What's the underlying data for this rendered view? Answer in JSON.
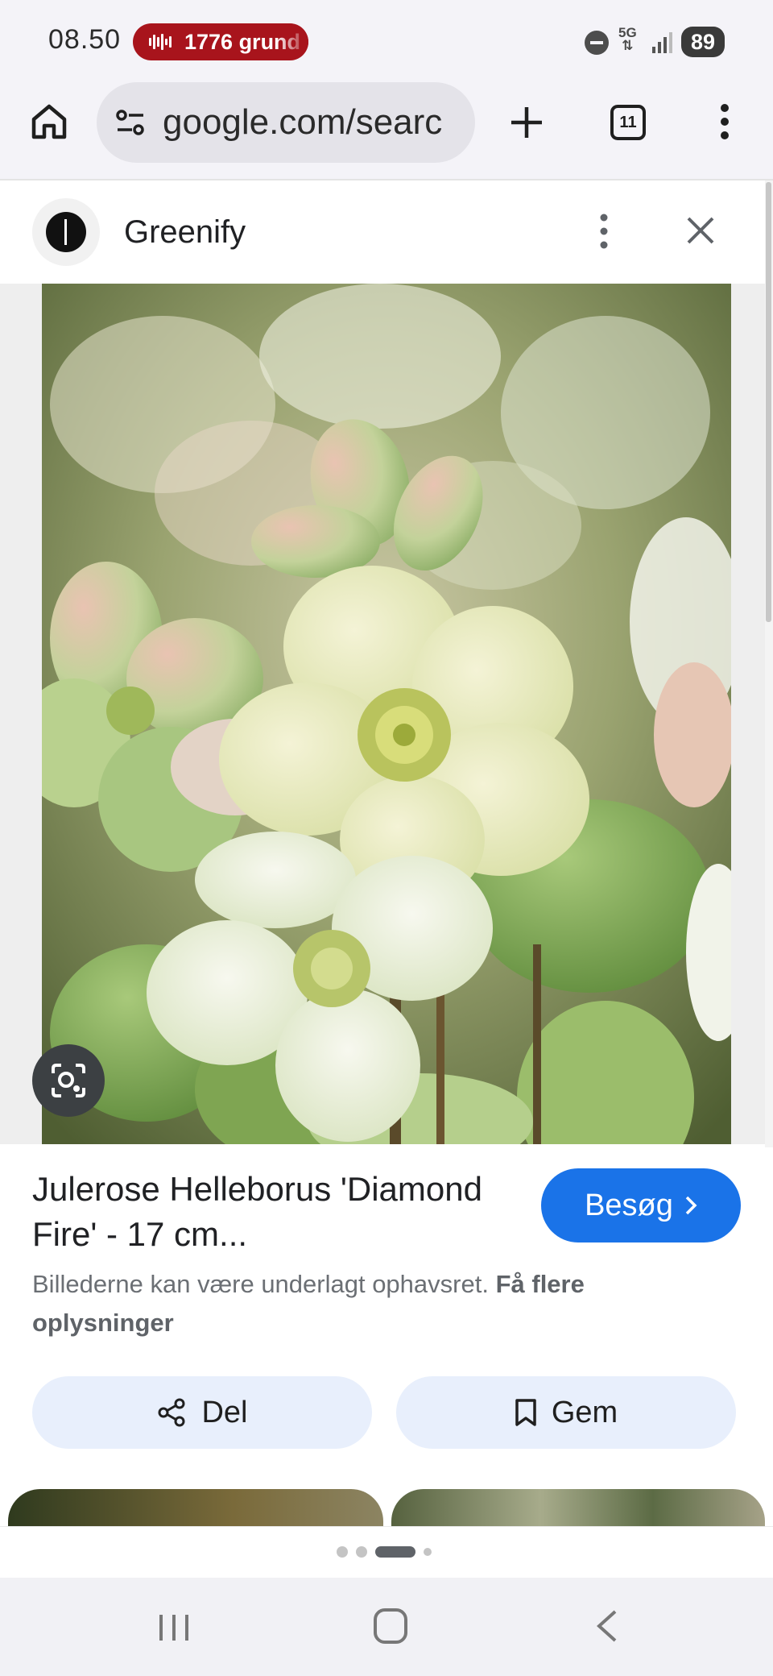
{
  "status_bar": {
    "time": "08.50",
    "recording_pill": "1776 grund",
    "network": "5G",
    "battery": "89"
  },
  "browser": {
    "url": "google.com/searc",
    "tab_count": "11"
  },
  "panel": {
    "site_name": "Greenify"
  },
  "result": {
    "title": "Julerose Helleborus 'Diamond Fire' - 17 cm...",
    "visit_label": "Besøg",
    "copyright_prefix": "Billederne kan være underlagt ophavsret.",
    "copyright_link": "Få flere oplysninger",
    "share_label": "Del",
    "save_label": "Gem"
  },
  "pager": {
    "total": 4,
    "active_index": 2
  },
  "colors": {
    "accent": "#1a73e8",
    "recording": "#a8141c",
    "chip_bg": "#e8effc"
  },
  "icons": {
    "home": "home-icon",
    "site_settings": "tune-icon",
    "new_tab": "plus-icon",
    "tabs": "tabs-icon",
    "menu": "more-vert-icon",
    "close": "close-icon",
    "lens": "lens-icon",
    "share": "share-icon",
    "bookmark": "bookmark-icon"
  }
}
